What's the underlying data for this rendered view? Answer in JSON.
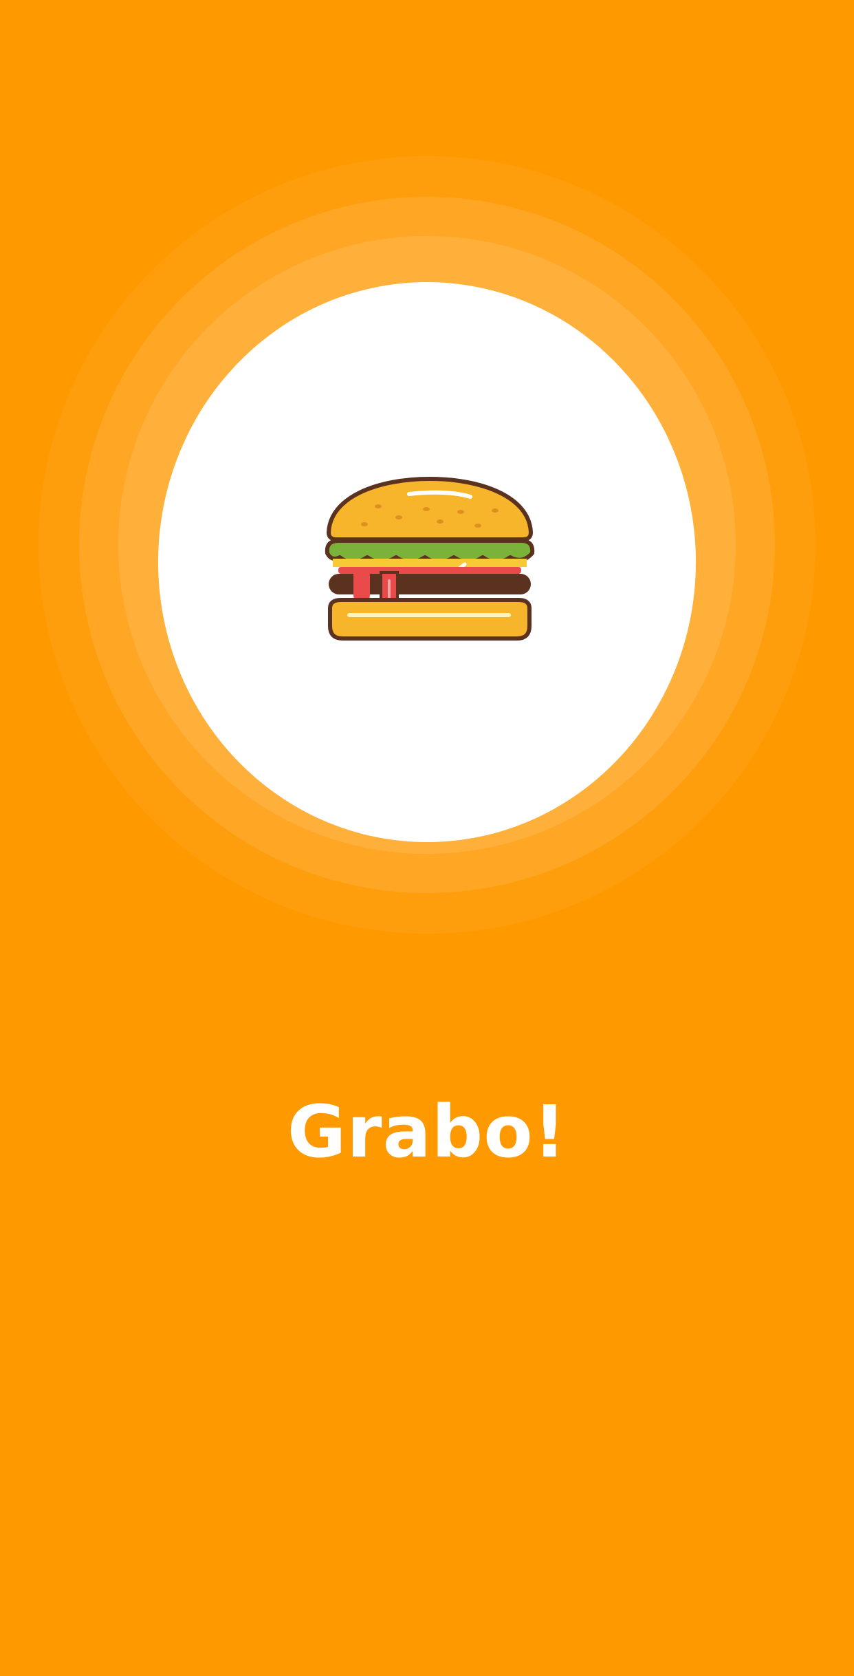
{
  "app": {
    "name": "Grabo!"
  },
  "logo": {
    "icon": "burger-icon"
  },
  "colors": {
    "background": "#FF9900",
    "circle": "#FFFFFF",
    "text": "#FFFFFF"
  }
}
